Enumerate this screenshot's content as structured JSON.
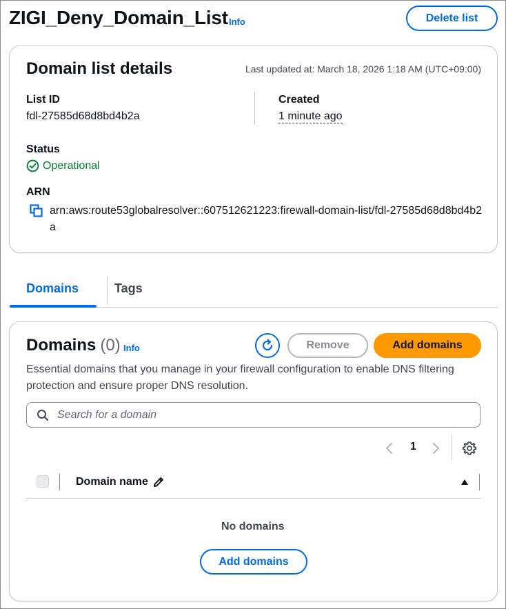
{
  "header": {
    "title": "ZIGI_Deny_Domain_List",
    "info_label": "Info",
    "delete_label": "Delete list"
  },
  "details": {
    "title": "Domain list details",
    "last_updated": "Last updated at: March 18, 2026 1:18 AM (UTC+09:00)",
    "list_id_label": "List ID",
    "list_id_value": "fdl-27585d68d8bd4b2a",
    "created_label": "Created",
    "created_value": "1 minute ago",
    "status_label": "Status",
    "status_value": "Operational",
    "arn_label": "ARN",
    "arn_value": "arn:aws:route53globalresolver::607512621223:firewall-domain-list/fdl-27585d68d8bd4b2a"
  },
  "tabs": [
    {
      "label": "Domains",
      "active": true
    },
    {
      "label": "Tags",
      "active": false
    }
  ],
  "domains": {
    "title": "Domains",
    "count": "(0)",
    "info_label": "Info",
    "remove_label": "Remove",
    "add_label": "Add domains",
    "description": "Essential domains that you manage in your firewall configuration to enable DNS filtering protection and ensure proper DNS resolution.",
    "search_placeholder": "Search for a domain",
    "page": "1",
    "column_header": "Domain name",
    "empty_title": "No domains",
    "empty_add_label": "Add domains"
  },
  "colors": {
    "accent": "#006ce0",
    "primary": "#ff9900",
    "success": "#00802f"
  },
  "icons": [
    "copy-icon",
    "success-circle-icon",
    "refresh-icon",
    "search-icon",
    "chevron-left-icon",
    "chevron-right-icon",
    "gear-icon",
    "pencil-icon",
    "sort-up-icon"
  ]
}
